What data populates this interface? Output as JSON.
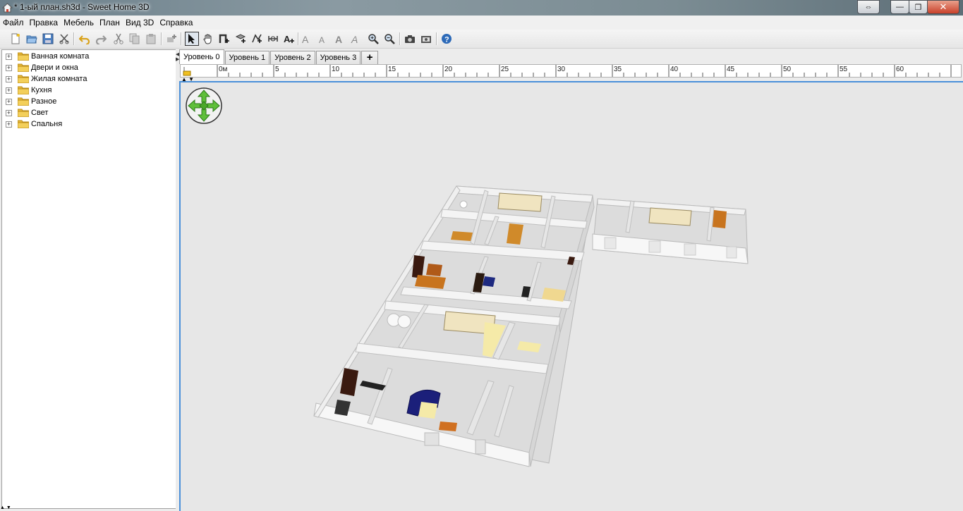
{
  "window": {
    "title": "* 1-ый план.sh3d - Sweet Home 3D",
    "controls": {
      "restore_label": "⇔",
      "minimize_label": "—",
      "maximize_label": "❐",
      "close_label": "✕"
    }
  },
  "menu": {
    "items": [
      "Файл",
      "Правка",
      "Мебель",
      "План",
      "Вид 3D",
      "Справка"
    ]
  },
  "toolbar": {
    "buttons": [
      "new-file-icon",
      "open-folder-icon",
      "save-icon",
      "cut-preferences-icon",
      "undo-icon",
      "redo-icon",
      "cut-icon",
      "copy-icon",
      "paste-icon",
      "add-furniture-icon",
      "select-arrow-icon",
      "pan-hand-icon",
      "create-walls-icon",
      "create-rooms-icon",
      "create-polylines-icon",
      "create-dimensions-icon",
      "add-text-icon",
      "increase-text-icon",
      "decrease-text-icon",
      "bold-text-icon",
      "italic-text-icon",
      "zoom-in-icon",
      "zoom-out-icon",
      "create-photo-icon",
      "create-video-icon",
      "help-icon"
    ]
  },
  "catalog": {
    "categories": [
      "Ванная комната",
      "Двери и окна",
      "Жилая комната",
      "Кухня",
      "Разное",
      "Свет",
      "Спальня"
    ],
    "toggle_symbol": "+"
  },
  "levels": {
    "tabs": [
      "Уровень 0",
      "Уровень 1",
      "Уровень 2",
      "Уровень 3"
    ],
    "active_index": 0,
    "add_label": "+"
  },
  "ruler": {
    "labels": [
      "0м",
      "5",
      "10",
      "15",
      "20",
      "25",
      "30",
      "35",
      "40",
      "45",
      "50",
      "55",
      "60"
    ]
  },
  "colors": {
    "accent_border": "#4a90d9",
    "view_background": "#e7e7e7",
    "folder": "#e8b93a",
    "compass_green": "#5fbf3a"
  }
}
